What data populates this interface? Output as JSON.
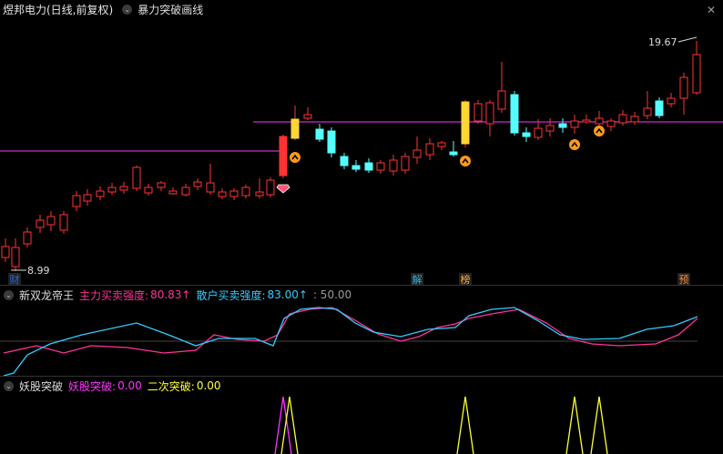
{
  "main": {
    "stock_title": "煜邦电力(日线,前复权)",
    "indicator_title": "暴力突破画线",
    "high_label": "19.67",
    "low_label": "8.99",
    "markers": [
      "财",
      "解",
      "榜",
      "预"
    ]
  },
  "mid": {
    "title": "新双龙帝王",
    "main_force_label": "主力买卖强度:",
    "main_force_value": "80.83↑",
    "retail_label": "散户买卖强度:",
    "retail_value": "83.00↑",
    "level_label": ": 50.00"
  },
  "low": {
    "title": "妖股突破",
    "yao_label": "妖股突破:",
    "yao_value": "0.00",
    "second_label": "二次突破:",
    "second_value": "0.00"
  },
  "colors": {
    "up": "#ff3333",
    "down": "#54ffff",
    "magenta": "#ff33ff",
    "yellow": "#ffff33",
    "main_line": "#ff3399",
    "retail_line": "#33ccff"
  }
}
